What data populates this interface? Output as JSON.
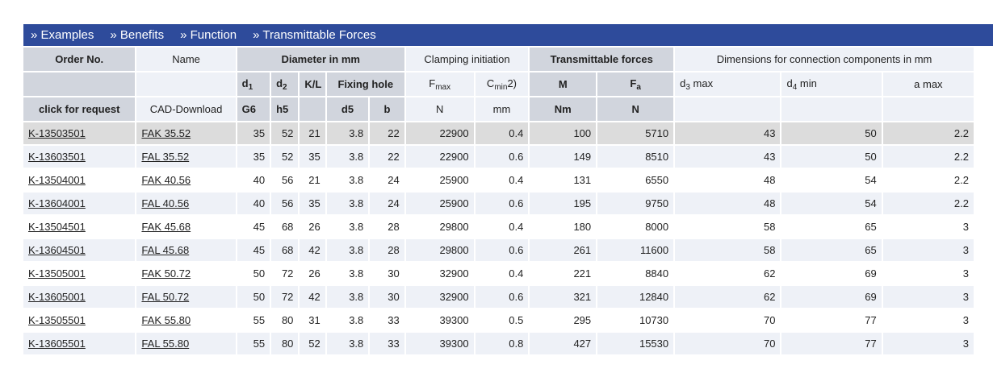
{
  "nav": {
    "items": [
      {
        "label": "» Examples"
      },
      {
        "label": "» Benefits"
      },
      {
        "label": "» Function"
      },
      {
        "label": "» Transmittable Forces"
      }
    ]
  },
  "headers": {
    "order_no": "Order No.",
    "name": "Name",
    "diameter": "Diameter in mm",
    "clamping": "Clamping initiation",
    "transmittable": "Transmittable forces",
    "dimensions": "Dimensions for connection components in mm",
    "d1": "d",
    "d1_sub": "1",
    "d2": "d",
    "d2_sub": "2",
    "kl": "K/L",
    "fixing_hole": "Fixing hole",
    "fmax": "F",
    "fmax_sub": "max",
    "cmin": "C",
    "cmin_sub": "min",
    "cmin_suffix": "2)",
    "m": "M",
    "fa": "F",
    "fa_sub": "a",
    "d3max": "d",
    "d3max_sub": "3",
    "d3max_suffix": " max",
    "d4min": "d",
    "d4min_sub": "4",
    "d4min_suffix": " min",
    "amax": "a max",
    "click_for_request": "click for request",
    "cad_download": "CAD-Download",
    "g6": "G6",
    "h5": "h5",
    "d5": "d5",
    "b": "b",
    "unit_n": "N",
    "unit_mm": "mm",
    "unit_nm": "Nm",
    "unit_n2": "N"
  },
  "rows": [
    [
      "K-13503501",
      "FAK 35.52",
      "35",
      "52",
      "21",
      "3.8",
      "22",
      "22900",
      "0.4",
      "100",
      "5710",
      "43",
      "50",
      "2.2"
    ],
    [
      "K-13603501",
      "FAL 35.52",
      "35",
      "52",
      "35",
      "3.8",
      "22",
      "22900",
      "0.6",
      "149",
      "8510",
      "43",
      "50",
      "2.2"
    ],
    [
      "K-13504001",
      "FAK 40.56",
      "40",
      "56",
      "21",
      "3.8",
      "24",
      "25900",
      "0.4",
      "131",
      "6550",
      "48",
      "54",
      "2.2"
    ],
    [
      "K-13604001",
      "FAL 40.56",
      "40",
      "56",
      "35",
      "3.8",
      "24",
      "25900",
      "0.6",
      "195",
      "9750",
      "48",
      "54",
      "2.2"
    ],
    [
      "K-13504501",
      "FAK 45.68",
      "45",
      "68",
      "26",
      "3.8",
      "28",
      "29800",
      "0.4",
      "180",
      "8000",
      "58",
      "65",
      "3"
    ],
    [
      "K-13604501",
      "FAL 45.68",
      "45",
      "68",
      "42",
      "3.8",
      "28",
      "29800",
      "0.6",
      "261",
      "11600",
      "58",
      "65",
      "3"
    ],
    [
      "K-13505001",
      "FAK 50.72",
      "50",
      "72",
      "26",
      "3.8",
      "30",
      "32900",
      "0.4",
      "221",
      "8840",
      "62",
      "69",
      "3"
    ],
    [
      "K-13605001",
      "FAL 50.72",
      "50",
      "72",
      "42",
      "3.8",
      "30",
      "32900",
      "0.6",
      "321",
      "12840",
      "62",
      "69",
      "3"
    ],
    [
      "K-13505501",
      "FAK 55.80",
      "55",
      "80",
      "31",
      "3.8",
      "33",
      "39300",
      "0.5",
      "295",
      "10730",
      "70",
      "77",
      "3"
    ],
    [
      "K-13605501",
      "FAL 55.80",
      "55",
      "80",
      "52",
      "3.8",
      "33",
      "39300",
      "0.8",
      "427",
      "15530",
      "70",
      "77",
      "3"
    ]
  ]
}
